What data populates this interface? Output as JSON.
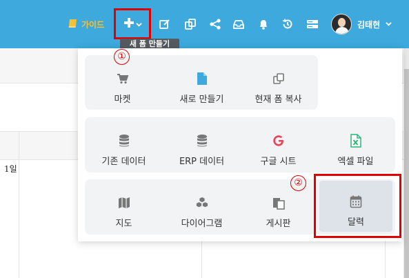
{
  "topbar": {
    "guide_label": "가이드",
    "tooltip": "새 폼 만들기",
    "user_name": "김태현",
    "icons": [
      "plus-icon",
      "edit-icon",
      "copy-icon",
      "share-icon",
      "inbox-icon",
      "bell-icon",
      "history-icon",
      "server-icon"
    ],
    "color": "#3da9dc"
  },
  "calendar_bg": {
    "day": "1일"
  },
  "menu": {
    "groups": [
      {
        "items": [
          {
            "label": "마켓",
            "icon": "cart-icon"
          },
          {
            "label": "새로 만들기",
            "icon": "file-icon"
          },
          {
            "label": "현재 폼 복사",
            "icon": "copy-icon"
          }
        ]
      },
      {
        "items": [
          {
            "label": "기존 데이터",
            "icon": "database-icon"
          },
          {
            "label": "ERP 데이터",
            "icon": "database-icon"
          },
          {
            "label": "구글 시트",
            "icon": "google-icon"
          },
          {
            "label": "엑셀 파일",
            "icon": "excel-icon"
          }
        ]
      },
      {
        "items": [
          {
            "label": "지도",
            "icon": "map-icon"
          },
          {
            "label": "다이어그램",
            "icon": "cubes-icon"
          },
          {
            "label": "게시판",
            "icon": "board-icon"
          },
          {
            "label": "달력",
            "icon": "calendar-icon"
          }
        ]
      }
    ]
  },
  "annotations": {
    "step1": "①",
    "step2": "②",
    "color": "#e00000"
  }
}
